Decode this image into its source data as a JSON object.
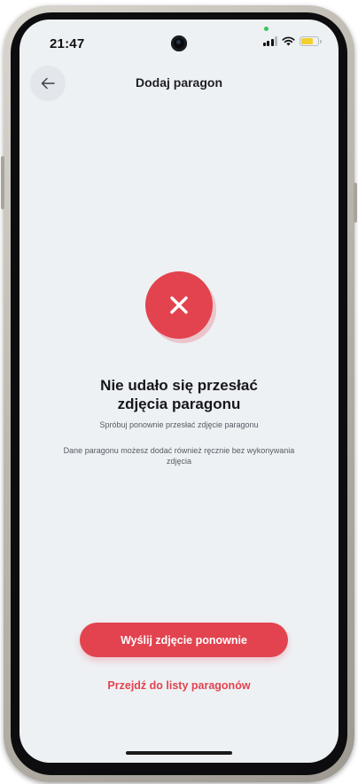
{
  "status_bar": {
    "time": "21:47",
    "battery_color": "#f2d02e"
  },
  "header": {
    "title": "Dodaj paragon",
    "back_icon": "arrow-left-icon"
  },
  "error": {
    "icon": "close-icon",
    "title_line1": "Nie udało się przesłać",
    "title_line2": "zdjęcia paragonu",
    "subtitle": "Spróbuj ponownie przesłać zdjęcie paragonu",
    "info": "Dane paragonu możesz dodać również ręcznie bez wykonywania zdjęcia"
  },
  "actions": {
    "retry_label": "Wyślij zdjęcie ponownie",
    "list_link_label": "Przejdź do listy paragonów"
  },
  "colors": {
    "accent": "#e2434f",
    "background": "#eef1f4"
  }
}
